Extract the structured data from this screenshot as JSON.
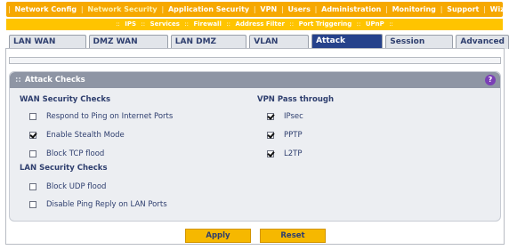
{
  "top_nav": [
    "Network Config",
    "Network Security",
    "Application Security",
    "VPN",
    "Users",
    "Administration",
    "Monitoring",
    "Support",
    "Wizards"
  ],
  "top_nav_active": "Network Security",
  "sub_nav": [
    "IPS",
    "Services",
    "Firewall",
    "Address Filter",
    "Port Triggering",
    "UPnP"
  ],
  "sub_nav_active": "Firewall",
  "tabs": [
    "LAN WAN Rules",
    "DMZ WAN Rules",
    "LAN DMZ Rules",
    "VLAN Rules",
    "Attack Checks",
    "Session Limit",
    "Advanced"
  ],
  "active_tab": "Attack Checks",
  "section": {
    "title": "Attack Checks",
    "help_icon": "help-icon",
    "wan": {
      "title": "WAN Security Checks",
      "options": [
        {
          "label": "Respond to Ping on Internet Ports",
          "checked": false
        },
        {
          "label": "Enable Stealth Mode",
          "checked": true
        },
        {
          "label": "Block TCP flood",
          "checked": false
        }
      ]
    },
    "lan": {
      "title": "LAN Security Checks",
      "options": [
        {
          "label": "Block UDP flood",
          "checked": false
        },
        {
          "label": "Disable Ping Reply on LAN Ports",
          "checked": false
        }
      ]
    },
    "vpn": {
      "title": "VPN Pass through",
      "options": [
        {
          "label": "IPsec",
          "checked": true
        },
        {
          "label": "PPTP",
          "checked": true
        },
        {
          "label": "L2TP",
          "checked": true
        }
      ]
    }
  },
  "buttons": {
    "apply": "Apply",
    "reset": "Reset"
  },
  "colors": {
    "nav_orange": "#f6a800",
    "subnav_yellow": "#ffc400",
    "tab_active": "#26428b",
    "text_navy": "#2e3e6e",
    "button": "#f6b800"
  }
}
